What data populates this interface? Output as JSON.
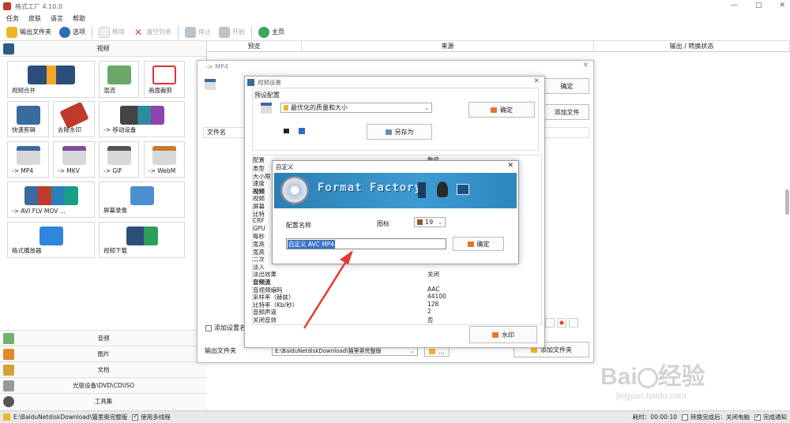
{
  "window": {
    "title": "格式工厂 4.10.0"
  },
  "menu": [
    "任务",
    "皮肤",
    "语言",
    "帮助"
  ],
  "toolbar": {
    "output_folder": "输出文件夹",
    "options": "选项",
    "remove": "移除",
    "clear_list": "清空列表",
    "stop": "停止",
    "start": "开始",
    "home": "主页"
  },
  "left": {
    "video_header": "视频",
    "tiles": [
      "视频合并",
      "混流",
      "画面裁剪",
      "快速剪辑",
      "去除水印",
      "-> 移动设备",
      "-> MP4",
      "-> MKV",
      "-> GIF",
      "-> WebM",
      "-> AVI FLV MOV ...",
      "屏幕录像",
      "格式播放器",
      "视频下载"
    ],
    "sections": [
      "音频",
      "图片",
      "文档",
      "光驱设备\\DVD\\CD\\ISO",
      "工具集"
    ]
  },
  "list_header": {
    "preview": "预览",
    "source": "来源",
    "output": "输出 / 转换状态"
  },
  "mp4_dialog": {
    "title": "-> MP4",
    "ok": "确定",
    "add_file": "添加文件",
    "filename": "文件名",
    "add_settings_name": "添加设置名",
    "output_folder": "输出文件夹",
    "output_path": "E:\\BaiduNetdiskDownload\\猫里奥完整版",
    "browse": "...",
    "watermark": "水印",
    "add_file2": "添加文件夹"
  },
  "video_settings": {
    "title": "视频设置",
    "preset_label": "预设配置",
    "preset_value": "最优化的质量和大小",
    "ok": "确定",
    "save_as": "另存为",
    "table_header_key": "配置",
    "table_header_val": "数值",
    "rows": [
      {
        "k": "类型",
        "v": ""
      },
      {
        "k": "大小限",
        "v": ""
      },
      {
        "k": "速度",
        "v": ""
      },
      {
        "k": "视频",
        "v": "",
        "sec": true
      },
      {
        "k": "视频",
        "v": ""
      },
      {
        "k": "屏幕",
        "v": ""
      },
      {
        "k": "比特",
        "v": ""
      },
      {
        "k": "CRF",
        "v": ""
      },
      {
        "k": "GPU",
        "v": ""
      },
      {
        "k": "每秒",
        "v": ""
      },
      {
        "k": "宽高",
        "v": ""
      },
      {
        "k": "宽高",
        "v": ""
      },
      {
        "k": "二次",
        "v": ""
      },
      {
        "k": "淡入",
        "v": ""
      },
      {
        "k": "淡出效果",
        "v": "关闭"
      },
      {
        "k": "音频流",
        "v": "",
        "sec": true
      },
      {
        "k": "音视频编码",
        "v": "AAC"
      },
      {
        "k": "采样率（赫兹）",
        "v": "44100"
      },
      {
        "k": "比特率（Kb/秒）",
        "v": "128"
      },
      {
        "k": "音频声道",
        "v": "2"
      },
      {
        "k": "关闭音效",
        "v": "否"
      }
    ]
  },
  "custom_dialog": {
    "title": "自定义",
    "banner": "Format Factory",
    "config_name_label": "配置名称",
    "icon_label": "图标",
    "icon_value": "19",
    "name_value": "自定义 AVC MP4",
    "ok": "确定"
  },
  "status": {
    "path": "E:\\BaiduNetdiskDownload\\猫里奥完整版",
    "multithread": "使用多线程",
    "elapsed": "耗时：00:00:10",
    "after_convert": "转换完成后：关闭电脑",
    "notify": "完成通知"
  },
  "watermark": {
    "line1": "Baidu 经验",
    "line2": "jingyan.baidu.com"
  }
}
